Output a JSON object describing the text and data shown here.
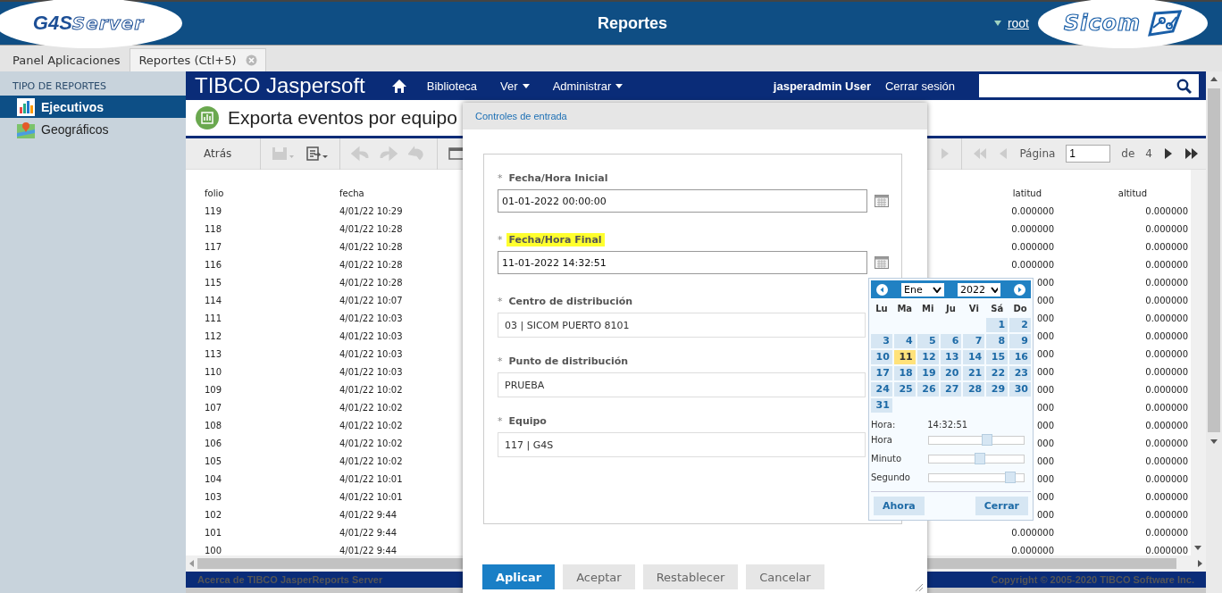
{
  "header": {
    "logo_left": {
      "brand": "G4S",
      "suffix": "Server"
    },
    "title": "Reportes",
    "user": "root",
    "logo_right": {
      "brand": "Sicom"
    }
  },
  "tabs": [
    {
      "label": "Panel Aplicaciones",
      "selected": false,
      "closable": false
    },
    {
      "label": "Reportes (Ctl+5)",
      "selected": true,
      "closable": true
    }
  ],
  "sidebar": {
    "heading": "TIPO DE REPORTES",
    "items": [
      {
        "label": "Ejecutivos",
        "selected": true
      },
      {
        "label": "Geográficos",
        "selected": false
      }
    ]
  },
  "nav": {
    "brand": "TIBCO",
    "product": "Jaspersoft",
    "menu": [
      {
        "label": "Biblioteca",
        "dropdown": false
      },
      {
        "label": "Ver",
        "dropdown": true
      },
      {
        "label": "Administrar",
        "dropdown": true
      }
    ],
    "user": "jasperadmin User",
    "logout": "Cerrar sesión"
  },
  "report": {
    "title": "Exporta eventos por equipo"
  },
  "toolbar": {
    "back": "Atrás",
    "pager": {
      "label": "Página",
      "page": "1",
      "of": "de",
      "total": "4"
    }
  },
  "table": {
    "columns": [
      "folio",
      "fecha",
      "latitud",
      "altitud"
    ],
    "rows": [
      [
        "119",
        "4/01/22 10:29",
        "0.000000",
        "0.000000"
      ],
      [
        "118",
        "4/01/22 10:28",
        "0.000000",
        "0.000000"
      ],
      [
        "117",
        "4/01/22 10:28",
        "0.000000",
        "0.000000"
      ],
      [
        "116",
        "4/01/22 10:28",
        "0.000000",
        "0.000000"
      ],
      [
        "115",
        "4/01/22 10:28",
        "000",
        "0.000000"
      ],
      [
        "114",
        "4/01/22 10:07",
        "000",
        "0.000000"
      ],
      [
        "111",
        "4/01/22 10:03",
        "000",
        "0.000000"
      ],
      [
        "112",
        "4/01/22 10:03",
        "000",
        "0.000000"
      ],
      [
        "113",
        "4/01/22 10:03",
        "000",
        "0.000000"
      ],
      [
        "110",
        "4/01/22 10:03",
        "000",
        "0.000000"
      ],
      [
        "109",
        "4/01/22 10:02",
        "000",
        "0.000000"
      ],
      [
        "107",
        "4/01/22 10:02",
        "000",
        "0.000000"
      ],
      [
        "108",
        "4/01/22 10:02",
        "000",
        "0.000000"
      ],
      [
        "106",
        "4/01/22 10:02",
        "000",
        "0.000000"
      ],
      [
        "105",
        "4/01/22 10:02",
        "000",
        "0.000000"
      ],
      [
        "104",
        "4/01/22 10:01",
        "000",
        "0.000000"
      ],
      [
        "103",
        "4/01/22 10:01",
        "000",
        "0.000000"
      ],
      [
        "102",
        "4/01/22 9:44",
        "000",
        "0.000000"
      ],
      [
        "101",
        "4/01/22 9:44",
        "0.000000",
        "0.000000"
      ],
      [
        "100",
        "4/01/22 9:44",
        "0.000000",
        "0.000000"
      ]
    ]
  },
  "footer": {
    "about": "Acerca de TIBCO JasperReports Server",
    "copyright": "Copyright © 2005-2020 TIBCO Software Inc."
  },
  "dialog": {
    "title": "Controles de entrada",
    "fields": [
      {
        "kind": "date",
        "mark": "*",
        "label": "Fecha/Hora Inicial",
        "value": "01-01-2022 00:00:00",
        "highlighted": false
      },
      {
        "kind": "date",
        "mark": "*",
        "label": "Fecha/Hora Final",
        "value": "11-01-2022 14:32:51",
        "highlighted": true
      },
      {
        "kind": "select",
        "mark": "*",
        "label": "Centro de distribución",
        "value": "03 | SICOM PUERTO 8101",
        "highlighted": false
      },
      {
        "kind": "select",
        "mark": "*",
        "label": "Punto de distribución",
        "value": "PRUEBA",
        "highlighted": false
      },
      {
        "kind": "select",
        "mark": "*",
        "label": "Equipo",
        "value": "117 | G4S",
        "highlighted": false
      }
    ],
    "buttons": [
      {
        "label": "Aplicar",
        "primary": true
      },
      {
        "label": "Aceptar",
        "primary": false
      },
      {
        "label": "Restablecer",
        "primary": false
      },
      {
        "label": "Cancelar",
        "primary": false
      }
    ]
  },
  "calendar": {
    "month": "Ene",
    "year": "2022",
    "weekdays": [
      "Lu",
      "Ma",
      "Mi",
      "Ju",
      "Vi",
      "Sá",
      "Do"
    ],
    "weeks": [
      [
        {
          "kind": "blank"
        },
        {
          "kind": "blank"
        },
        {
          "kind": "blank"
        },
        {
          "kind": "blank"
        },
        {
          "kind": "blank"
        },
        {
          "kind": "day",
          "label": "1",
          "selected": false
        },
        {
          "kind": "day",
          "label": "2",
          "selected": false
        }
      ],
      [
        {
          "label": "3",
          "selected": false
        },
        {
          "label": "4",
          "selected": false
        },
        {
          "label": "5",
          "selected": false
        },
        {
          "label": "6",
          "selected": false
        },
        {
          "label": "7",
          "selected": false
        },
        {
          "label": "8",
          "selected": false
        },
        {
          "label": "9",
          "selected": false
        }
      ],
      [
        {
          "label": "10",
          "selected": false
        },
        {
          "label": "11",
          "selected": true
        },
        {
          "label": "12",
          "selected": false
        },
        {
          "label": "13",
          "selected": false
        },
        {
          "label": "14",
          "selected": false
        },
        {
          "label": "15",
          "selected": false
        },
        {
          "label": "16",
          "selected": false
        }
      ],
      [
        {
          "label": "17",
          "selected": false
        },
        {
          "label": "18",
          "selected": false
        },
        {
          "label": "19",
          "selected": false
        },
        {
          "label": "20",
          "selected": false
        },
        {
          "label": "21",
          "selected": false
        },
        {
          "label": "22",
          "selected": false
        },
        {
          "label": "23",
          "selected": false
        }
      ],
      [
        {
          "label": "24",
          "selected": false
        },
        {
          "label": "25",
          "selected": false
        },
        {
          "label": "26",
          "selected": false
        },
        {
          "label": "27",
          "selected": false
        },
        {
          "label": "28",
          "selected": false
        },
        {
          "label": "29",
          "selected": false
        },
        {
          "label": "30",
          "selected": false
        }
      ],
      [
        {
          "label": "31",
          "selected": false
        }
      ]
    ],
    "time_label": "Hora:",
    "time": "14:32:51",
    "sliders": [
      {
        "label": "Hora",
        "level": 0.61
      },
      {
        "label": "Minuto",
        "level": 0.54
      },
      {
        "label": "Segundo",
        "level": 0.86
      }
    ],
    "buttons": [
      "Ahora",
      "Cerrar"
    ]
  }
}
